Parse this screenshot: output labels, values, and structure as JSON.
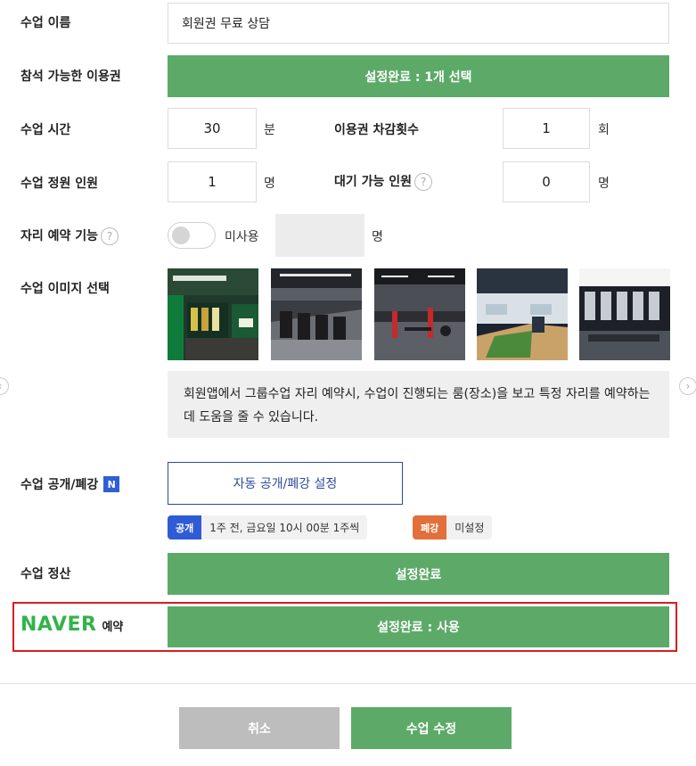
{
  "fields": {
    "class_name_label": "수업 이름",
    "class_name_value": "회원권 무료 상담",
    "tickets_label": "참석 가능한 이용권",
    "tickets_button": "설정완료 : 1개 선택",
    "duration_label": "수업 시간",
    "duration_value": "30",
    "duration_unit": "분",
    "deduct_label": "이용권 차감횟수",
    "deduct_value": "1",
    "deduct_unit": "회",
    "capacity_label": "수업 정원 인원",
    "capacity_value": "1",
    "capacity_unit": "명",
    "waitlist_label": "대기 가능 인원",
    "waitlist_value": "0",
    "waitlist_unit": "명",
    "seat_label": "자리 예약 기능",
    "seat_toggle_text": "미사용",
    "seat_unit": "명",
    "image_label": "수업 이미지 선택",
    "image_note": "회원앱에서 그룹수업 자리 예약시, 수업이 진행되는 룸(장소)을 보고 특정 자리를 예약하는데 도움을 줄 수 있습니다.",
    "visibility_label": "수업 공개/폐강",
    "visibility_badge": "N",
    "visibility_button": "자동 공개/폐강 설정",
    "open_tag": "공개",
    "open_text": "1주 전, 금요일 10시 00분 1주씩",
    "close_tag": "폐강",
    "close_text": "미설정",
    "settlement_label": "수업 정산",
    "settlement_button": "설정완료",
    "naver_logo": "NAVER",
    "naver_suffix": "예약",
    "naver_button": "설정완료 : 사용",
    "help_glyph": "?"
  },
  "footer": {
    "cancel_label": "취소",
    "submit_label": "수업 수정"
  },
  "nav": {
    "prev_glyph": "‹",
    "next_glyph": "›"
  },
  "colors": {
    "green": "#5daa68",
    "naver_green": "#33b34a",
    "blue": "#2e4a9c",
    "open_tag": "#2f5bd6",
    "close_tag": "#e2703a",
    "highlight": "#d81e1e",
    "cancel_gray": "#bdbdbd"
  },
  "icons": [
    "help-icon",
    "toggle-switch",
    "naver-n-icon",
    "prev-arrow-icon",
    "next-arrow-icon"
  ]
}
